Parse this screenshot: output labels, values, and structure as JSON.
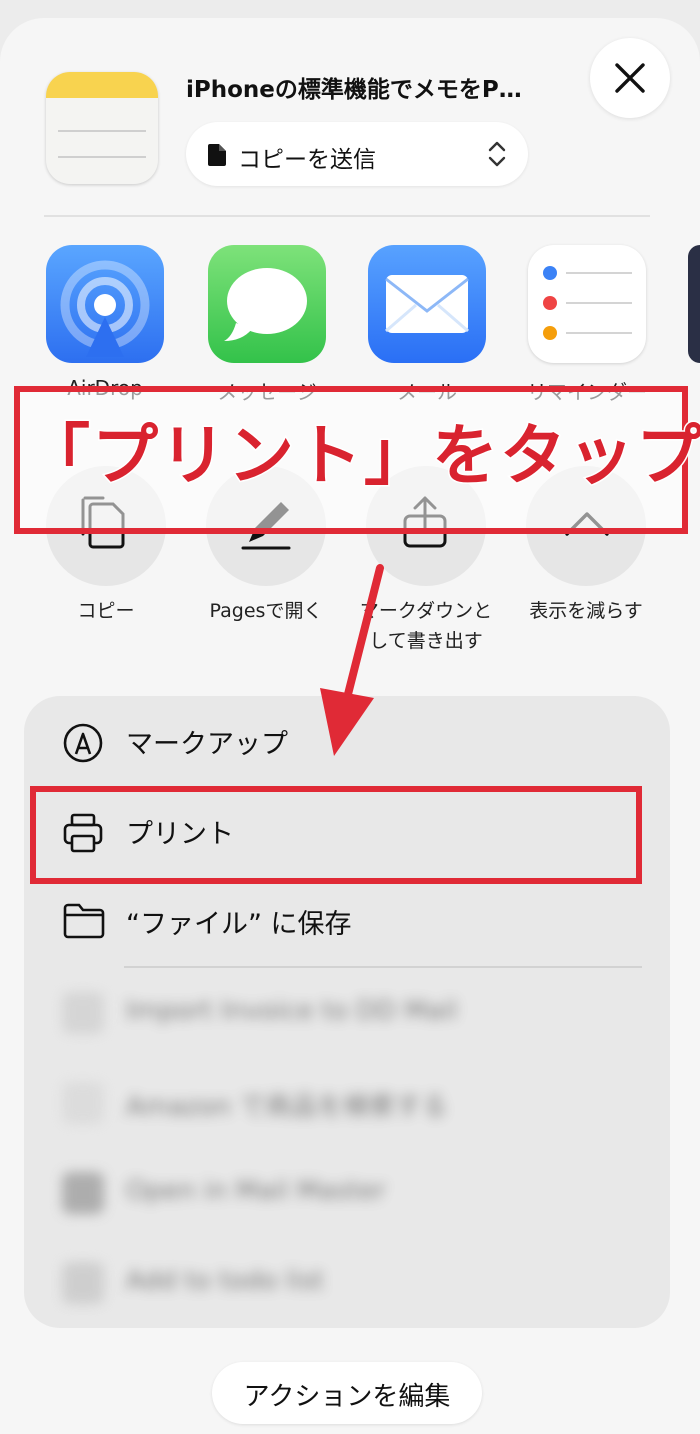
{
  "header": {
    "title": "iPhoneの標準機能でメモをP…",
    "send_mode": "コピーを送信"
  },
  "apps": [
    {
      "label": "AirDrop",
      "color": "#3b82f6"
    },
    {
      "label": "メッセージ",
      "color": "#4cd964"
    },
    {
      "label": "メール",
      "color": "#2f7cf6"
    },
    {
      "label": "リマインダー",
      "color": "#ffffff"
    }
  ],
  "actions": [
    {
      "label": "コピー",
      "icon": "copy-icon"
    },
    {
      "label": "Pagesで開く",
      "icon": "pen-icon"
    },
    {
      "label_line1": "マークダウンと",
      "label_line2": "して書き出す",
      "icon": "export-icon"
    },
    {
      "label": "表示を減らす",
      "icon": "chevron-up-icon"
    }
  ],
  "annotation": {
    "text": "「プリント」をタップ",
    "color": "#e02a36"
  },
  "menu": [
    {
      "label": "マークアップ",
      "icon": "markup-icon"
    },
    {
      "label": "プリント",
      "icon": "printer-icon"
    },
    {
      "label": "“ファイル” に保存",
      "icon": "folder-icon"
    }
  ],
  "blurred_menu": [
    "Import Invoice to DD Mail",
    "Amazon で商品を検索する",
    "Open in Mail Master",
    "Add to todo list"
  ],
  "footer": {
    "edit_actions": "アクションを編集"
  }
}
